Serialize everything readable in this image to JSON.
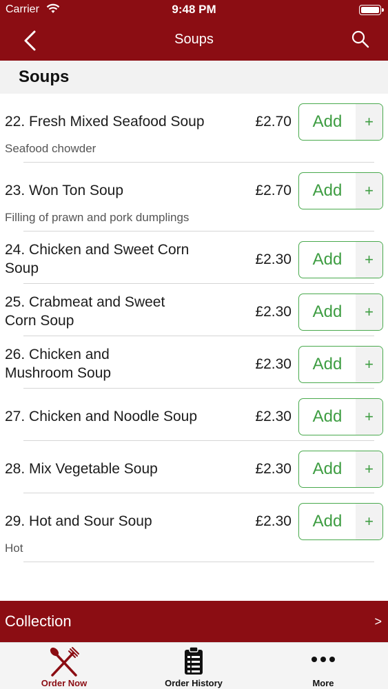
{
  "status_bar": {
    "carrier": "Carrier",
    "time": "9:48 PM"
  },
  "nav": {
    "title": "Soups",
    "back_icon": "chevron-left-icon",
    "search_icon": "search-icon"
  },
  "section": {
    "title": "Soups"
  },
  "add_label": "Add",
  "plus_label": "+",
  "items": [
    {
      "name": "22. Fresh Mixed Seafood Soup",
      "description": "Seafood chowder",
      "price": "£2.70"
    },
    {
      "name": "23. Won Ton Soup",
      "description": "Filling of prawn and pork dumplings",
      "price": "£2.70"
    },
    {
      "name": "24. Chicken and Sweet Corn Soup",
      "description": "",
      "price": "£2.30"
    },
    {
      "name": "25. Crabmeat and Sweet Corn Soup",
      "description": "",
      "price": "£2.30"
    },
    {
      "name": "26. Chicken and Mushroom Soup",
      "description": "",
      "price": "£2.30"
    },
    {
      "name": "27. Chicken and Noodle Soup",
      "description": "",
      "price": "£2.30"
    },
    {
      "name": "28. Mix Vegetable Soup",
      "description": "",
      "price": "£2.30"
    },
    {
      "name": "29. Hot and Sour Soup",
      "description": "Hot",
      "price": "£2.30"
    }
  ],
  "collection": {
    "label": "Collection",
    "chevron": ">"
  },
  "tabs": [
    {
      "label": "Order Now",
      "icon": "fork-knife-icon",
      "active": true
    },
    {
      "label": "Order History",
      "icon": "clipboard-list-icon",
      "active": false
    },
    {
      "label": "More",
      "icon": "more-dots-icon",
      "active": false
    }
  ],
  "colors": {
    "brand": "#8b0d13",
    "accent_green": "#48a94c"
  }
}
